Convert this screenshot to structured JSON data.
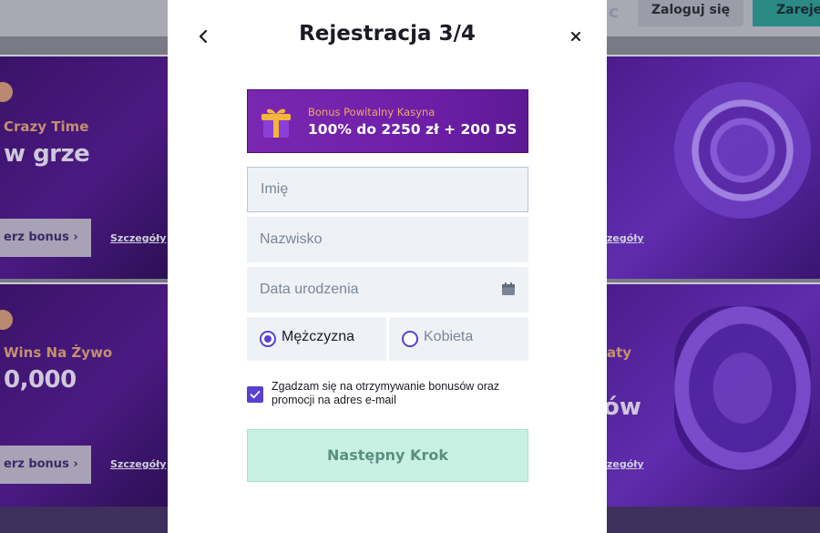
{
  "header": {
    "login_label": "Zaloguj się",
    "register_label": "Zarejes"
  },
  "background": {
    "cards_left": [
      {
        "subtitle": "Crazy Time",
        "headline": "w grze",
        "button_label": "erz bonus",
        "details_label": "Szczegóły"
      },
      {
        "subtitle": "Wins Na Żywo",
        "headline": "0,000",
        "button_label": "erz bonus",
        "details_label": "Szczegóły"
      }
    ],
    "cards_right": [
      {
        "details_label": "zegóły"
      },
      {
        "subtitle": "aty",
        "headline": "ów",
        "details_label": "zegóły"
      }
    ]
  },
  "modal": {
    "title": "Rejestracja 3/4",
    "bonus": {
      "subtitle": "Bonus Powitalny Kasyna",
      "main": "100% do 2250 zł + 200 DS"
    },
    "fields": {
      "first_name_placeholder": "Imię",
      "last_name_placeholder": "Nazwisko",
      "birthdate_placeholder": "Data urodzenia"
    },
    "gender": {
      "male_label": "Mężczyzna",
      "female_label": "Kobieta",
      "selected": "male"
    },
    "consent": {
      "text": "Zgadzam się na otrzymywanie bonusów oraz promocji na adres e-mail",
      "checked": true
    },
    "next_button_label": "Następny Krok"
  },
  "colors": {
    "accent": "#5a3fd0",
    "next_button_bg": "#c9f1e3",
    "bonus_bg": "#7a27b0",
    "field_bg": "#eef2f7"
  },
  "icons": {
    "back": "chevron-left-icon",
    "close": "close-icon",
    "gift": "gift-icon",
    "calendar": "calendar-icon"
  }
}
